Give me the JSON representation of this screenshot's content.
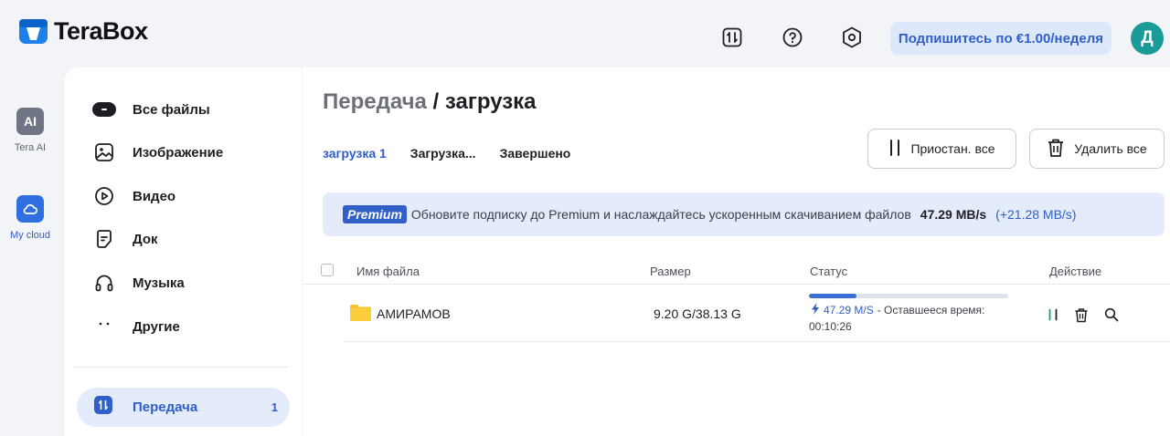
{
  "app": {
    "logo_text": "TeraBox"
  },
  "header": {
    "icons": [
      "transfer-icon",
      "help-icon",
      "settings-icon"
    ],
    "subscribe_label": "Подпишитесь по €1.00/неделя",
    "avatar_letter": "Д"
  },
  "rail": [
    {
      "label": "Tera AI",
      "icon": "ai-icon",
      "glyph": "AI"
    },
    {
      "label": "My cloud",
      "icon": "cloud-icon"
    }
  ],
  "sidebar": {
    "items": [
      {
        "label": "Все файлы",
        "icon": "all-files-icon"
      },
      {
        "label": "Изображение",
        "icon": "image-icon"
      },
      {
        "label": "Видео",
        "icon": "video-icon"
      },
      {
        "label": "Док",
        "icon": "document-icon"
      },
      {
        "label": "Музыка",
        "icon": "music-icon"
      },
      {
        "label": "Другие",
        "icon": "more-icon"
      }
    ],
    "active": {
      "label": "Передача",
      "count": "1",
      "icon": "transfer-icon"
    }
  },
  "main": {
    "breadcrumb_parent": "Передача",
    "breadcrumb_sep": " / ",
    "breadcrumb_current": "загрузка",
    "tabs": [
      "загрузка 1",
      "Загрузка...",
      "Завершено"
    ],
    "pause_all_label": "Приостан. все",
    "delete_all_label": "Удалить все",
    "banner": {
      "badge": "Premium",
      "message": "Обновите подписку до Premium и наслаждайтесь ускоренным скачиванием файлов",
      "speed": "47.29 MB/s",
      "boost": "(+21.28 MB/s)"
    },
    "columns": [
      "Имя файла",
      "Размер",
      "Статус",
      "Действие"
    ],
    "rows": [
      {
        "name": "АМИРАМОВ",
        "size": "9.20 G/38.13 G",
        "progress": 0.24,
        "speed": "47.29 M/S",
        "remaining_label": "- Оставшееся время:",
        "remaining": "00:10:26"
      }
    ]
  },
  "colors": {
    "accent": "#2f5fc7",
    "logo": "#1e7fe8",
    "avatar": "#1a9a98"
  }
}
